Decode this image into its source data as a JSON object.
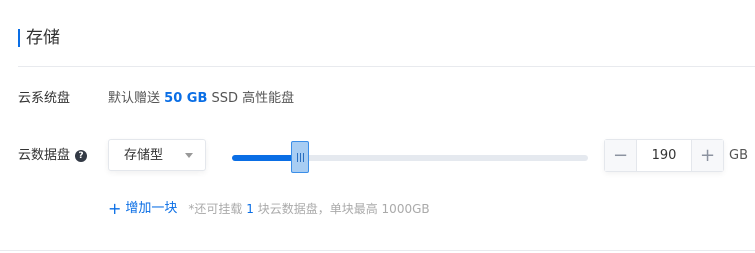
{
  "section": {
    "title": "存储"
  },
  "system_disk": {
    "label": "云系统盘",
    "prefix": "默认赠送",
    "size": "50 GB",
    "suffix": "SSD 高性能盘"
  },
  "data_disk": {
    "label": "云数据盘",
    "help_icon": "question-circle-icon",
    "type_select": {
      "selected": "存储型"
    },
    "slider": {
      "value": 190,
      "fill_fraction": 0.19
    },
    "stepper": {
      "minus": "−",
      "value": "190",
      "plus": "+"
    },
    "unit": "GB"
  },
  "add_disk": {
    "link_icon": "plus-icon",
    "link_label": "增加一块",
    "hint_prefix": "*还可挂载",
    "hint_count": "1",
    "hint_suffix": "块云数据盘，单块最高 1000GB"
  },
  "colors": {
    "accent": "#0a6ee5"
  }
}
